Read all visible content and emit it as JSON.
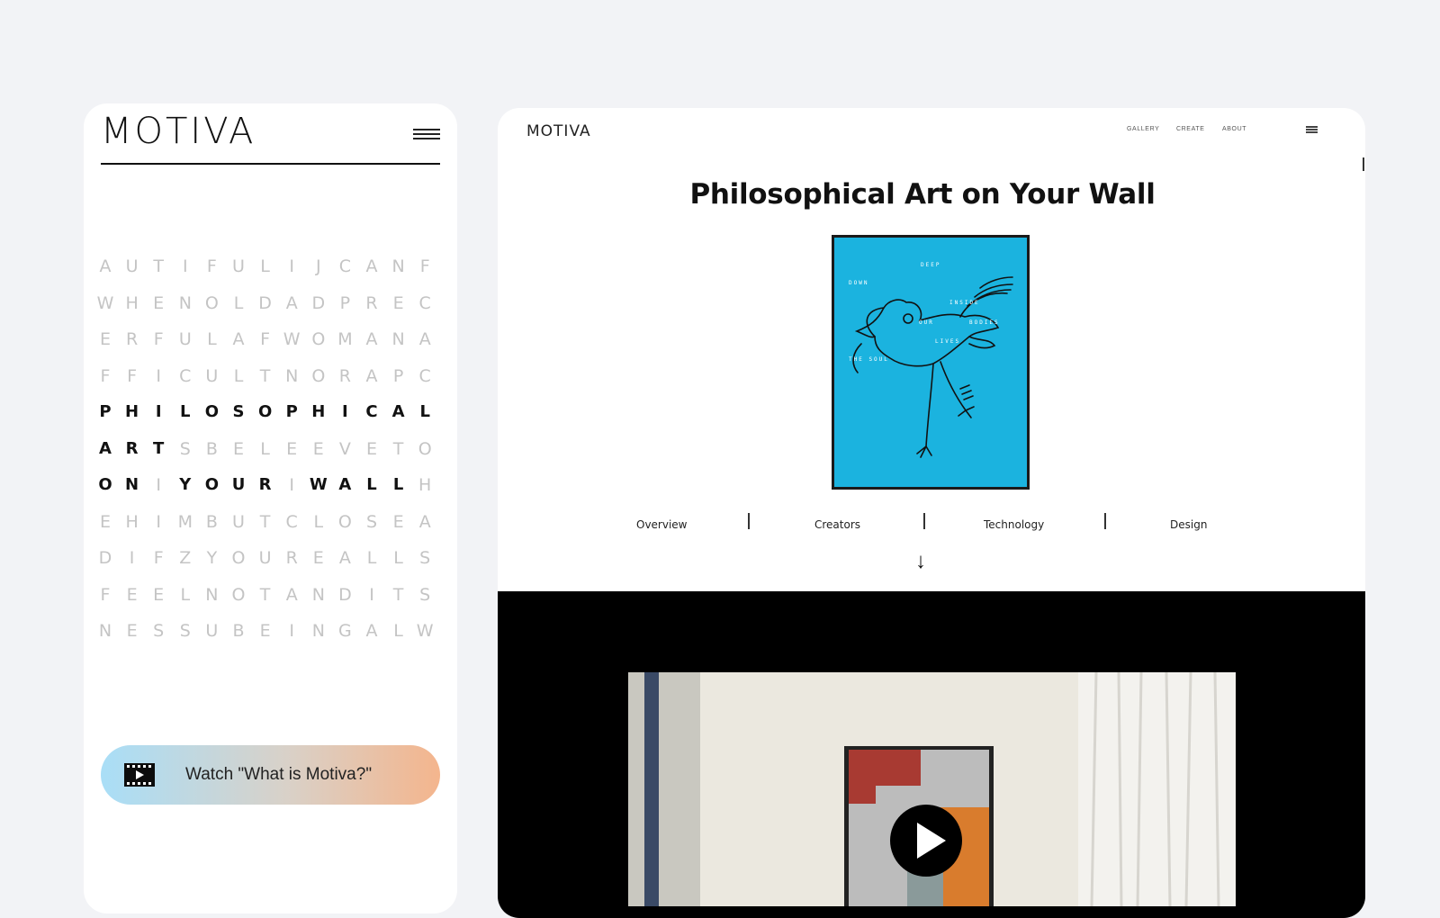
{
  "mobile": {
    "logo": "MOTIVA",
    "menu_icon": "hamburger-icon",
    "grid_rows": [
      [
        {
          "c": "A",
          "d": 0
        },
        {
          "c": "U",
          "d": 0
        },
        {
          "c": "T",
          "d": 0
        },
        {
          "c": "I",
          "d": 0
        },
        {
          "c": "F",
          "d": 0
        },
        {
          "c": "U",
          "d": 0
        },
        {
          "c": "L",
          "d": 0
        },
        {
          "c": "I",
          "d": 0
        },
        {
          "c": "J",
          "d": 0
        },
        {
          "c": "C",
          "d": 0
        },
        {
          "c": "A",
          "d": 0
        },
        {
          "c": "N",
          "d": 0
        },
        {
          "c": "F",
          "d": 0
        }
      ],
      [
        {
          "c": "W",
          "d": 0
        },
        {
          "c": "H",
          "d": 0
        },
        {
          "c": "E",
          "d": 0
        },
        {
          "c": "N",
          "d": 0
        },
        {
          "c": "O",
          "d": 0
        },
        {
          "c": "L",
          "d": 0
        },
        {
          "c": "D",
          "d": 0
        },
        {
          "c": "A",
          "d": 0
        },
        {
          "c": "D",
          "d": 0
        },
        {
          "c": "P",
          "d": 0
        },
        {
          "c": "R",
          "d": 0
        },
        {
          "c": "E",
          "d": 0
        },
        {
          "c": "C",
          "d": 0
        }
      ],
      [
        {
          "c": "E",
          "d": 0
        },
        {
          "c": "R",
          "d": 0
        },
        {
          "c": "F",
          "d": 0
        },
        {
          "c": "U",
          "d": 0
        },
        {
          "c": "L",
          "d": 0
        },
        {
          "c": "A",
          "d": 0
        },
        {
          "c": "F",
          "d": 0
        },
        {
          "c": "W",
          "d": 0
        },
        {
          "c": "O",
          "d": 0
        },
        {
          "c": "M",
          "d": 0
        },
        {
          "c": "A",
          "d": 0
        },
        {
          "c": "N",
          "d": 0
        },
        {
          "c": "A",
          "d": 0
        }
      ],
      [
        {
          "c": "F",
          "d": 0
        },
        {
          "c": "F",
          "d": 0
        },
        {
          "c": "I",
          "d": 0
        },
        {
          "c": "C",
          "d": 0
        },
        {
          "c": "U",
          "d": 0
        },
        {
          "c": "L",
          "d": 0
        },
        {
          "c": "T",
          "d": 0
        },
        {
          "c": "N",
          "d": 0
        },
        {
          "c": "O",
          "d": 0
        },
        {
          "c": "R",
          "d": 0
        },
        {
          "c": "A",
          "d": 0
        },
        {
          "c": "P",
          "d": 0
        },
        {
          "c": "C",
          "d": 0
        }
      ],
      [
        {
          "c": "P",
          "d": 1
        },
        {
          "c": "H",
          "d": 1
        },
        {
          "c": "I",
          "d": 1
        },
        {
          "c": "L",
          "d": 1
        },
        {
          "c": "O",
          "d": 1
        },
        {
          "c": "S",
          "d": 1
        },
        {
          "c": "O",
          "d": 1
        },
        {
          "c": "P",
          "d": 1
        },
        {
          "c": "H",
          "d": 1
        },
        {
          "c": "I",
          "d": 1
        },
        {
          "c": "C",
          "d": 1
        },
        {
          "c": "A",
          "d": 1
        },
        {
          "c": "L",
          "d": 1
        }
      ],
      [
        {
          "c": "A",
          "d": 1
        },
        {
          "c": "R",
          "d": 1
        },
        {
          "c": "T",
          "d": 1
        },
        {
          "c": "S",
          "d": 0
        },
        {
          "c": "B",
          "d": 0
        },
        {
          "c": "E",
          "d": 0
        },
        {
          "c": "L",
          "d": 0
        },
        {
          "c": "E",
          "d": 0
        },
        {
          "c": "E",
          "d": 0
        },
        {
          "c": "V",
          "d": 0
        },
        {
          "c": "E",
          "d": 0
        },
        {
          "c": "T",
          "d": 0
        },
        {
          "c": "O",
          "d": 0
        }
      ],
      [
        {
          "c": "O",
          "d": 1
        },
        {
          "c": "N",
          "d": 1
        },
        {
          "c": "I",
          "d": 0
        },
        {
          "c": "Y",
          "d": 1
        },
        {
          "c": "O",
          "d": 1
        },
        {
          "c": "U",
          "d": 1
        },
        {
          "c": "R",
          "d": 1
        },
        {
          "c": "I",
          "d": 0
        },
        {
          "c": "W",
          "d": 1
        },
        {
          "c": "A",
          "d": 1
        },
        {
          "c": "L",
          "d": 1
        },
        {
          "c": "L",
          "d": 1
        },
        {
          "c": "H",
          "d": 0
        }
      ],
      [
        {
          "c": "E",
          "d": 0
        },
        {
          "c": "H",
          "d": 0
        },
        {
          "c": "I",
          "d": 0
        },
        {
          "c": "M",
          "d": 0
        },
        {
          "c": "B",
          "d": 0
        },
        {
          "c": "U",
          "d": 0
        },
        {
          "c": "T",
          "d": 0
        },
        {
          "c": "C",
          "d": 0
        },
        {
          "c": "L",
          "d": 0
        },
        {
          "c": "O",
          "d": 0
        },
        {
          "c": "S",
          "d": 0
        },
        {
          "c": "E",
          "d": 0
        },
        {
          "c": "A",
          "d": 0
        }
      ],
      [
        {
          "c": "D",
          "d": 0
        },
        {
          "c": "I",
          "d": 0
        },
        {
          "c": "F",
          "d": 0
        },
        {
          "c": "Z",
          "d": 0
        },
        {
          "c": "Y",
          "d": 0
        },
        {
          "c": "O",
          "d": 0
        },
        {
          "c": "U",
          "d": 0
        },
        {
          "c": "R",
          "d": 0
        },
        {
          "c": "E",
          "d": 0
        },
        {
          "c": "A",
          "d": 0
        },
        {
          "c": "L",
          "d": 0
        },
        {
          "c": "L",
          "d": 0
        },
        {
          "c": "S",
          "d": 0
        }
      ],
      [
        {
          "c": "F",
          "d": 0
        },
        {
          "c": "E",
          "d": 0
        },
        {
          "c": "E",
          "d": 0
        },
        {
          "c": "L",
          "d": 0
        },
        {
          "c": "N",
          "d": 0
        },
        {
          "c": "O",
          "d": 0
        },
        {
          "c": "T",
          "d": 0
        },
        {
          "c": "A",
          "d": 0
        },
        {
          "c": "N",
          "d": 0
        },
        {
          "c": "D",
          "d": 0
        },
        {
          "c": "I",
          "d": 0
        },
        {
          "c": "T",
          "d": 0
        },
        {
          "c": "S",
          "d": 0
        }
      ],
      [
        {
          "c": "N",
          "d": 0
        },
        {
          "c": "E",
          "d": 0
        },
        {
          "c": "S",
          "d": 0
        },
        {
          "c": "S",
          "d": 0
        },
        {
          "c": "U",
          "d": 0
        },
        {
          "c": "B",
          "d": 0
        },
        {
          "c": "E",
          "d": 0
        },
        {
          "c": "I",
          "d": 0
        },
        {
          "c": "N",
          "d": 0
        },
        {
          "c": "G",
          "d": 0
        },
        {
          "c": "A",
          "d": 0
        },
        {
          "c": "L",
          "d": 0
        },
        {
          "c": "W",
          "d": 0
        }
      ]
    ],
    "watch_button": {
      "label": "Watch \"What is Motiva?\"",
      "icon": "film-play-icon"
    }
  },
  "desktop": {
    "logo": "MOTIVA",
    "nav": [
      "GALLERY",
      "CREATE",
      "ABOUT"
    ],
    "menu_icon": "hamburger-icon",
    "title": "Philosophical Art on Your Wall",
    "artwork": {
      "background": "#1bb3df",
      "words": [
        "DEEP",
        "DOWN",
        "INSIDE",
        "OUR",
        "BODIES",
        "LIVES",
        "THE SOUL"
      ]
    },
    "tabs": [
      "Overview",
      "Creators",
      "Technology",
      "Design"
    ],
    "scroll_icon": "arrow-down-icon",
    "video": {
      "play_icon": "play-icon"
    }
  }
}
